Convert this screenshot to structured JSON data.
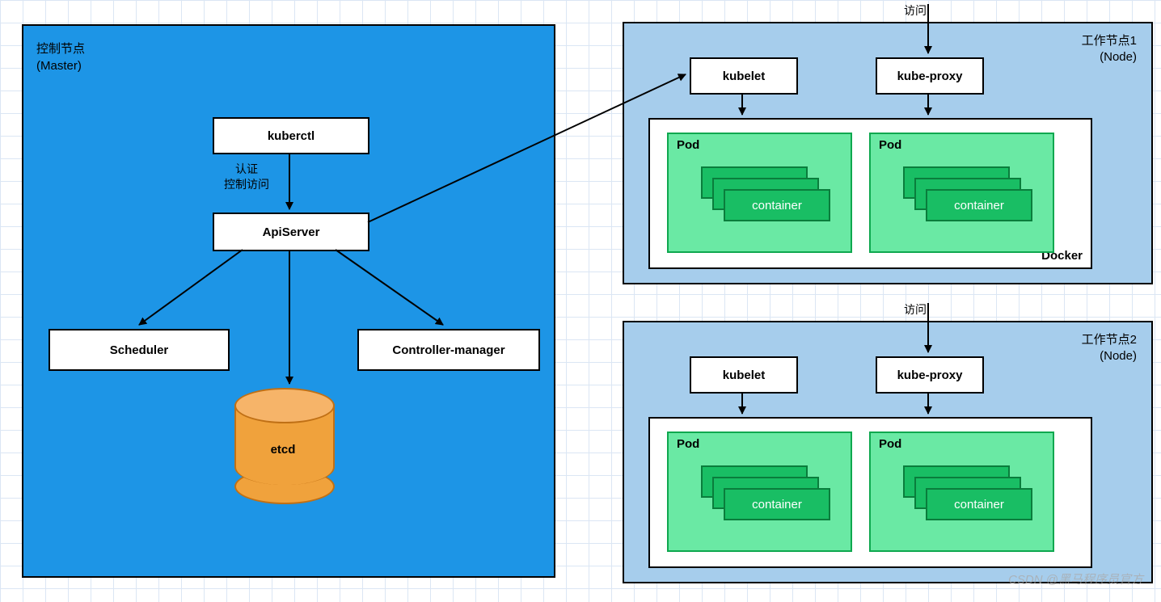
{
  "master": {
    "title1": "控制节点",
    "title2": "(Master)",
    "kuberctl": "kuberctl",
    "auth1": "认证",
    "auth2": "控制访问",
    "apiserver": "ApiServer",
    "scheduler": "Scheduler",
    "controller": "Controller-manager",
    "etcd": "etcd"
  },
  "worker1": {
    "access": "访问",
    "title1": "工作节点1",
    "title2": "(Node)",
    "kubelet": "kubelet",
    "kubeproxy": "kube-proxy",
    "docker": "Docker",
    "pod1": {
      "label": "Pod",
      "container": "container"
    },
    "pod2": {
      "label": "Pod",
      "container": "container"
    }
  },
  "worker2": {
    "access": "访问",
    "title1": "工作节点2",
    "title2": "(Node)",
    "kubelet": "kubelet",
    "kubeproxy": "kube-proxy",
    "pod1": {
      "label": "Pod",
      "container": "container"
    },
    "pod2": {
      "label": "Pod",
      "container": "container"
    }
  },
  "watermark": "CSDN @黑马程序员官方"
}
